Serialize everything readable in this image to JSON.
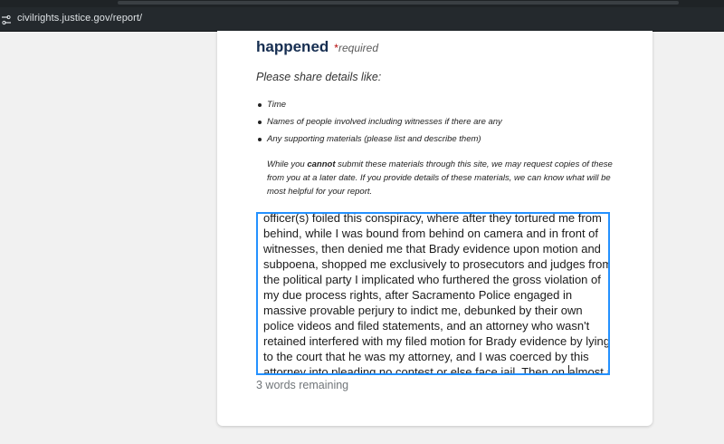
{
  "browser": {
    "url": "civilrights.justice.gov/report/"
  },
  "form": {
    "heading": "happened",
    "required_star": "*",
    "required_text": "required",
    "prompt": "Please share details like:",
    "bullets": [
      "Time",
      "Names of people involved including witnesses if there are any",
      "Any supporting materials (please list and describe them)"
    ],
    "note": {
      "before": "While you ",
      "emphasis": "cannot",
      "after": " submit these materials through this site, we may request copies of these from you at a later date. If you provide details of these materials, we can know what will be most helpful for your report."
    },
    "textarea_lines": [
      "officer(s) foiled this conspiracy, where after they tortured me from",
      "behind, while I was bound from behind on camera and in front of",
      "witnesses, then denied me that Brady evidence upon motion and",
      "subpoena, shopped me exclusively to prosecutors and judges from",
      "the political party I implicated who furthered the gross violation of",
      "my due process rights, after Sacramento Police engaged in",
      "massive provable perjury to indict me, debunked by their own",
      "police videos and filed statements, and an attorney who wasn't",
      "retained interfered with my filed motion for Brady evidence by lying",
      "to the court that he was my attorney, and I was coerced by this"
    ],
    "last_line_before_caret": "attorney into pleading no contest or else face jail. Then on ",
    "last_line_after_caret": "almost a",
    "word_counter": "3 words remaining"
  },
  "colors": {
    "heading": "#162e51",
    "required": "#b50909",
    "focus_border": "#2491ff",
    "counter": "#71767a"
  }
}
